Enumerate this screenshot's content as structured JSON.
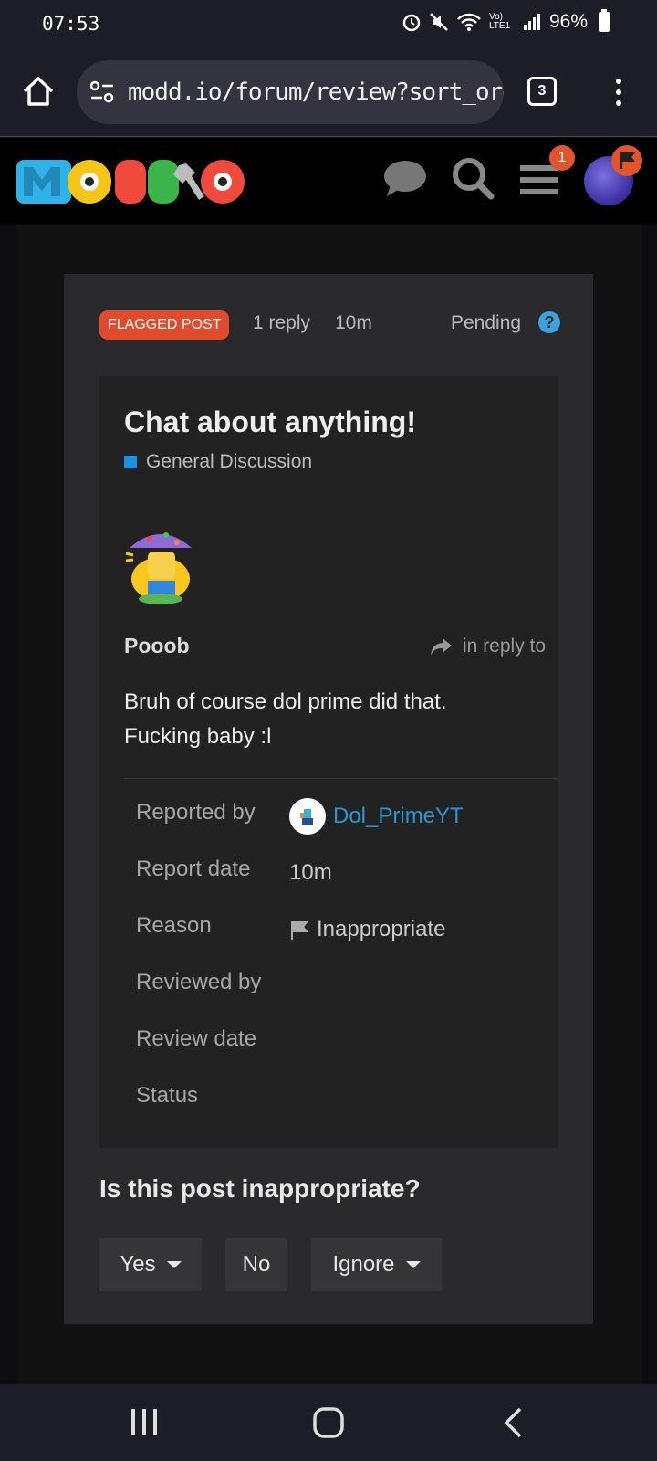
{
  "status_bar": {
    "time": "07:53",
    "battery": "96%",
    "network": "Vo) LTE1"
  },
  "browser": {
    "url": "modd.io/forum/review?sort_orde",
    "tab_count": "3"
  },
  "header": {
    "notification_count": "1"
  },
  "review": {
    "flag_label": "FLAGGED POST",
    "replies": "1 reply",
    "age": "10m",
    "status": "Pending",
    "help_symbol": "?"
  },
  "post": {
    "title": "Chat about anything!",
    "category": "General Discussion",
    "author": "Pooob",
    "reply_label": "in reply to",
    "body_line1": "Bruh of course dol prime did that.",
    "body_line2": "Fucking baby :l"
  },
  "details": {
    "reported_by_label": "Reported by",
    "reported_by_value": "Dol_PrimeYT",
    "report_date_label": "Report date",
    "report_date_value": "10m",
    "reason_label": "Reason",
    "reason_value": "Inappropriate",
    "reviewed_by_label": "Reviewed by",
    "review_date_label": "Review date",
    "status_label": "Status"
  },
  "actions": {
    "question": "Is this post inappropriate?",
    "yes": "Yes",
    "no": "No",
    "ignore": "Ignore"
  },
  "colors": {
    "accent": "#e04b2e",
    "link": "#2b95d0",
    "category": "#1e90e0"
  }
}
